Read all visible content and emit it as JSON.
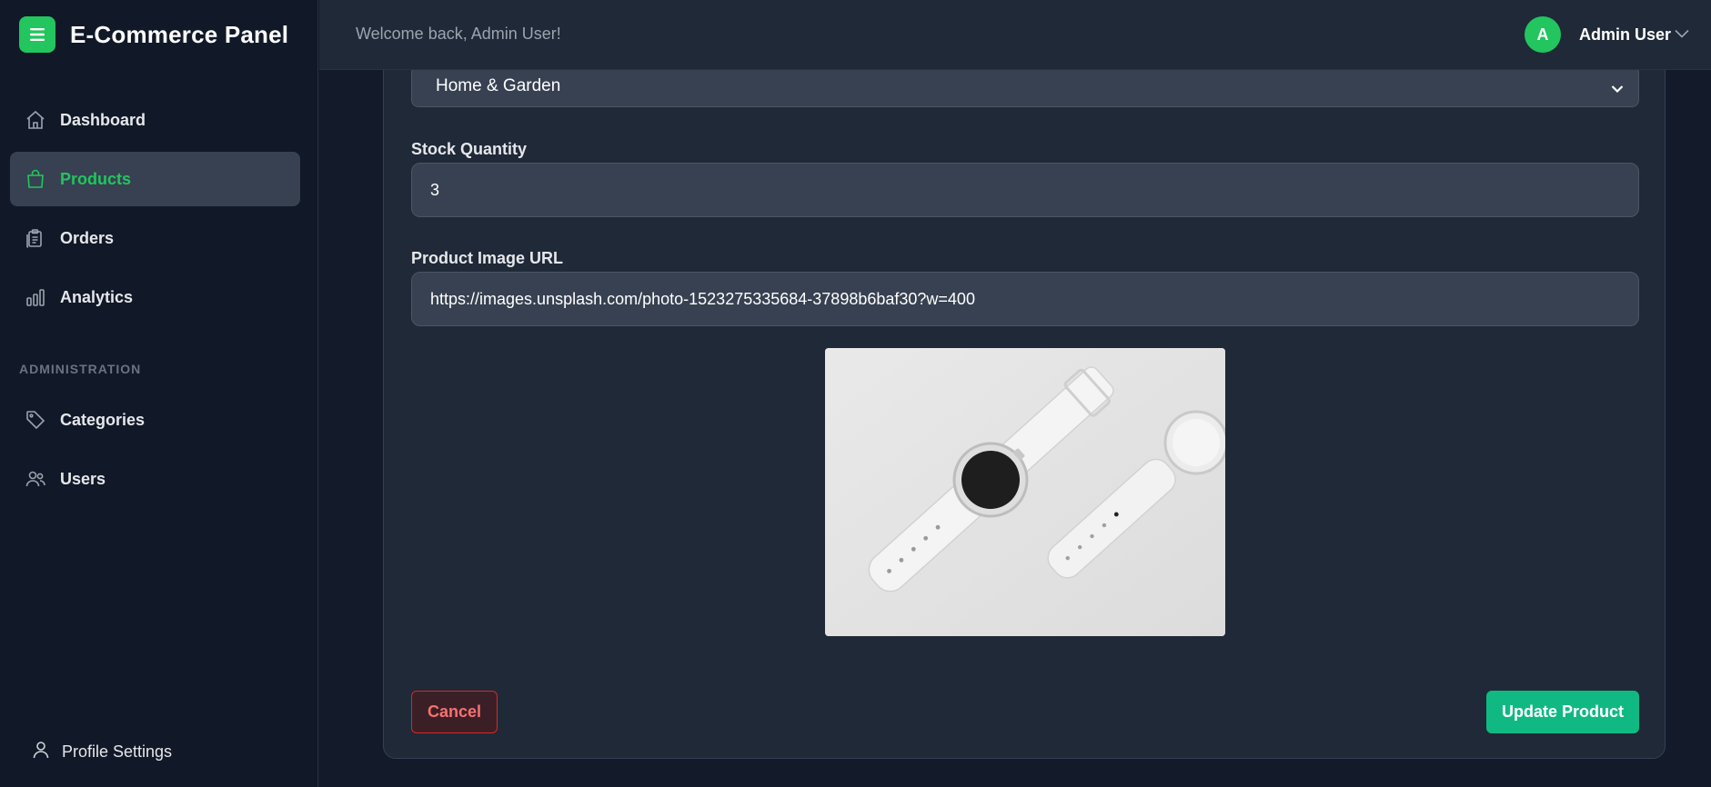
{
  "brand": {
    "title": "E-Commerce Panel",
    "logo_icon": "menu-icon",
    "accent": "#22c55e"
  },
  "sidebar": {
    "items": [
      {
        "label": "Dashboard",
        "icon": "home-icon",
        "active": false
      },
      {
        "label": "Products",
        "icon": "shopping-bag-icon",
        "active": true
      },
      {
        "label": "Orders",
        "icon": "clipboard-icon",
        "active": false
      },
      {
        "label": "Analytics",
        "icon": "bar-chart-icon",
        "active": false
      }
    ],
    "section_label": "ADMINISTRATION",
    "admin_items": [
      {
        "label": "Categories",
        "icon": "tag-icon"
      },
      {
        "label": "Users",
        "icon": "users-icon"
      }
    ],
    "profile_label": "Profile Settings"
  },
  "header": {
    "welcome": "Welcome back, Admin User!",
    "avatar_initial": "A",
    "user_name": "Admin User"
  },
  "form": {
    "category_value": "Home & Garden",
    "stock_label": "Stock Quantity",
    "stock_value": "3",
    "image_label": "Product Image URL",
    "image_value": "https://images.unsplash.com/photo-1523275335684-37898b6baf30?w=400",
    "cancel_label": "Cancel",
    "submit_label": "Update Product"
  },
  "colors": {
    "danger": "#dc2626",
    "success": "#10b981"
  }
}
